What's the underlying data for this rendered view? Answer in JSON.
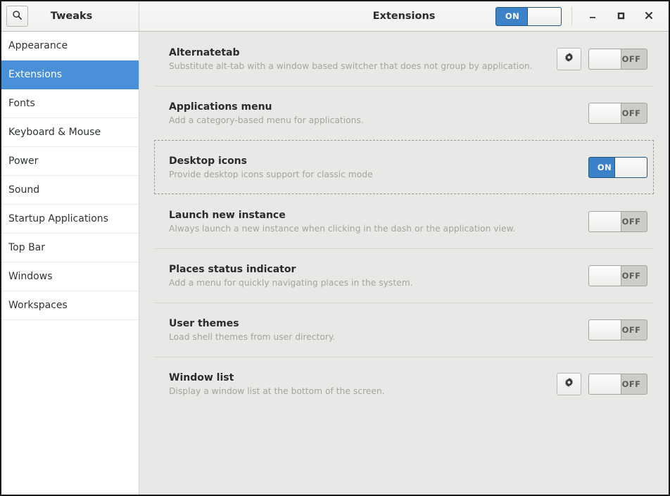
{
  "window": {
    "app_name": "Tweaks",
    "page_title": "Extensions",
    "search_icon": "search-icon",
    "global_switch": {
      "state": "on",
      "label": "ON"
    },
    "controls": {
      "minimize": "minimize-icon",
      "maximize": "maximize-icon",
      "close": "close-icon"
    }
  },
  "sidebar": {
    "items": [
      {
        "label": "Appearance",
        "selected": false
      },
      {
        "label": "Extensions",
        "selected": true
      },
      {
        "label": "Fonts",
        "selected": false
      },
      {
        "label": "Keyboard & Mouse",
        "selected": false
      },
      {
        "label": "Power",
        "selected": false
      },
      {
        "label": "Sound",
        "selected": false
      },
      {
        "label": "Startup Applications",
        "selected": false
      },
      {
        "label": "Top Bar",
        "selected": false
      },
      {
        "label": "Windows",
        "selected": false
      },
      {
        "label": "Workspaces",
        "selected": false
      }
    ]
  },
  "extensions": [
    {
      "name": "Alternatetab",
      "description": "Substitute alt-tab with a window based switcher that does not group by application.",
      "has_settings": true,
      "state": "off",
      "switch_label": "OFF",
      "focused": false,
      "separator": false
    },
    {
      "name": "Applications menu",
      "description": "Add a category-based menu for applications.",
      "has_settings": false,
      "state": "off",
      "switch_label": "OFF",
      "focused": false,
      "separator": true
    },
    {
      "name": "Desktop icons",
      "description": "Provide desktop icons support for classic mode",
      "has_settings": false,
      "state": "on",
      "switch_label": "ON",
      "focused": true,
      "separator": false
    },
    {
      "name": "Launch new instance",
      "description": "Always launch a new instance when clicking in the dash or the application view.",
      "has_settings": false,
      "state": "off",
      "switch_label": "OFF",
      "focused": false,
      "separator": false
    },
    {
      "name": "Places status indicator",
      "description": "Add a menu for quickly navigating places in the system.",
      "has_settings": false,
      "state": "off",
      "switch_label": "OFF",
      "focused": false,
      "separator": true
    },
    {
      "name": "User themes",
      "description": "Load shell themes from user directory.",
      "has_settings": false,
      "state": "off",
      "switch_label": "OFF",
      "focused": false,
      "separator": true
    },
    {
      "name": "Window list",
      "description": "Display a window list at the bottom of the screen.",
      "has_settings": true,
      "state": "off",
      "switch_label": "OFF",
      "focused": false,
      "separator": true
    }
  ],
  "colors": {
    "accent": "#4a90d9",
    "switch_on": "#3c82c8",
    "content_bg": "#e8e8e6",
    "sidebar_bg": "#ffffff"
  }
}
